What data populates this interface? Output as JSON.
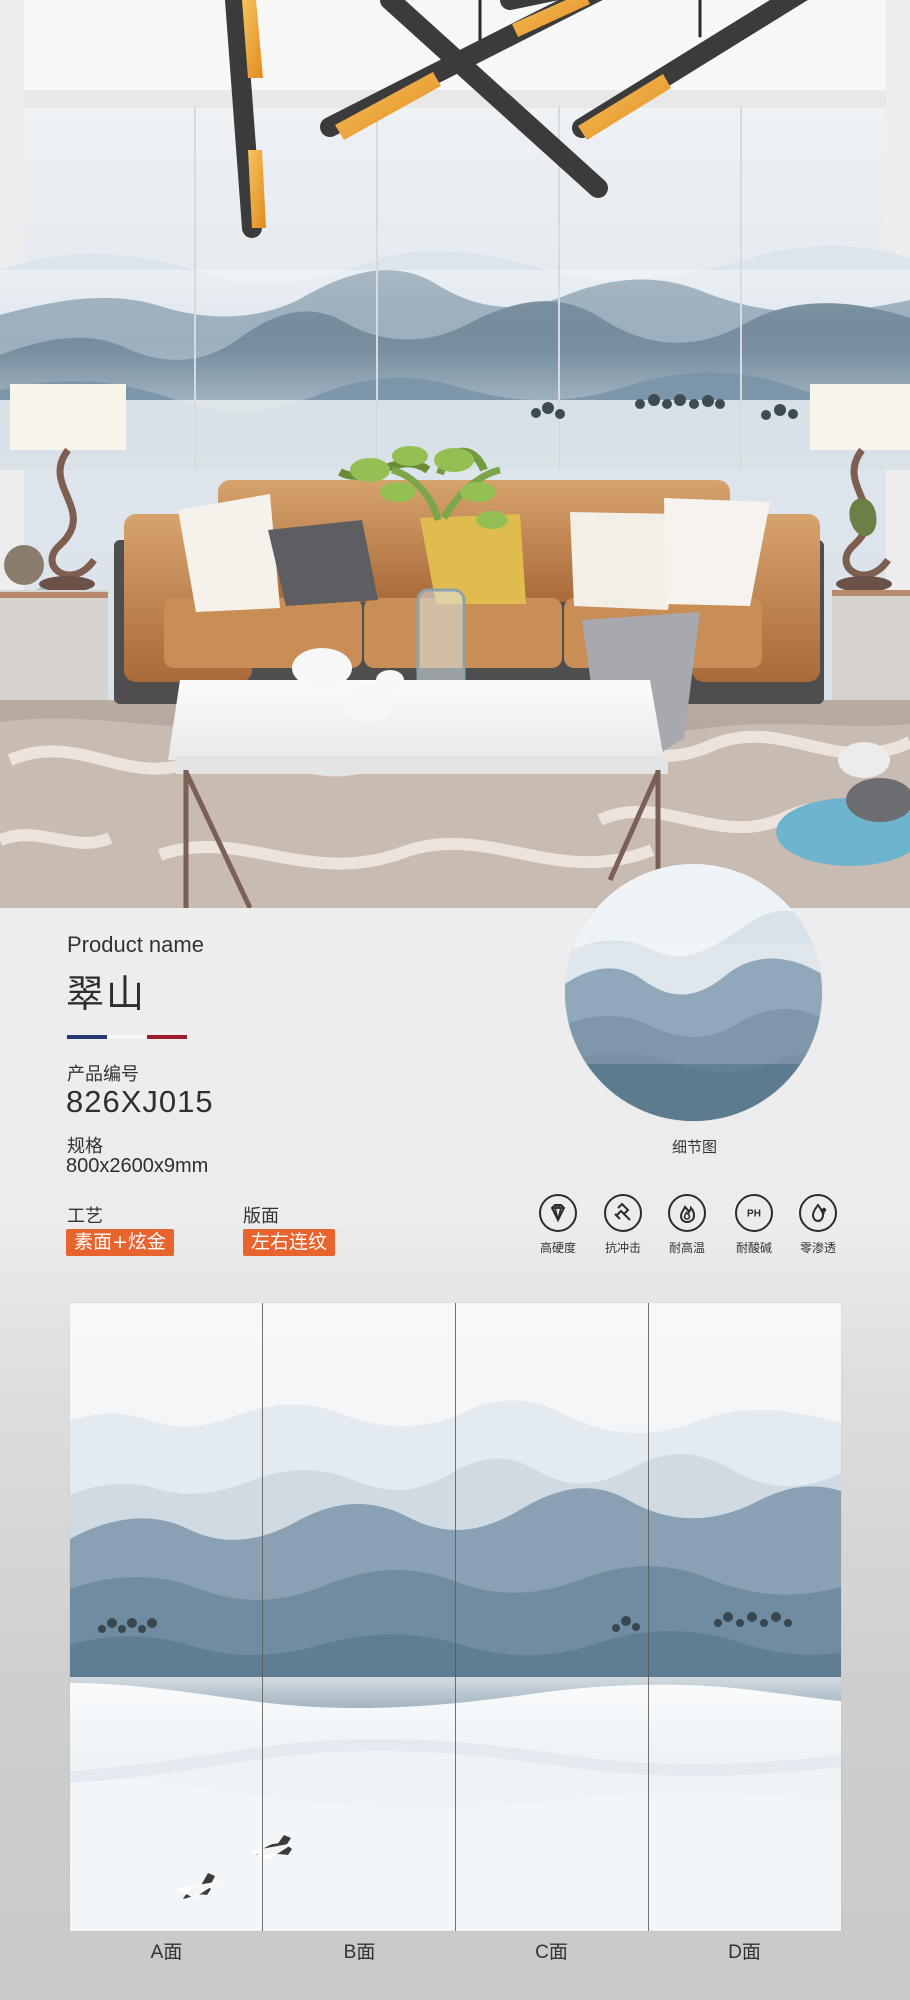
{
  "hero": {
    "scene": "living-room-with-landscape-wall-panels"
  },
  "product": {
    "name_label": "Product name",
    "name": "翠山",
    "code_label": "产品编号",
    "code": "826XJ015",
    "spec_label": "规格",
    "spec": "800x2600x9mm",
    "craft_label": "工艺",
    "craft": "素面+炫金",
    "layout_label": "版面",
    "layout": "左右连纹"
  },
  "detail": {
    "caption": "细节图"
  },
  "features": [
    {
      "icon": "diamond-icon",
      "label": "高硬度"
    },
    {
      "icon": "hammer-icon",
      "label": "抗冲击"
    },
    {
      "icon": "flame-icon",
      "label": "耐高温"
    },
    {
      "icon": "ph-icon",
      "label": "耐酸碱"
    },
    {
      "icon": "droplet-icon",
      "label": "零渗透"
    }
  ],
  "panels": {
    "labels": [
      "A面",
      "B面",
      "C面",
      "D面"
    ]
  },
  "colors": {
    "accent": "#e7642f",
    "flag_blue": "#243a73",
    "flag_red": "#9b1c2c"
  }
}
